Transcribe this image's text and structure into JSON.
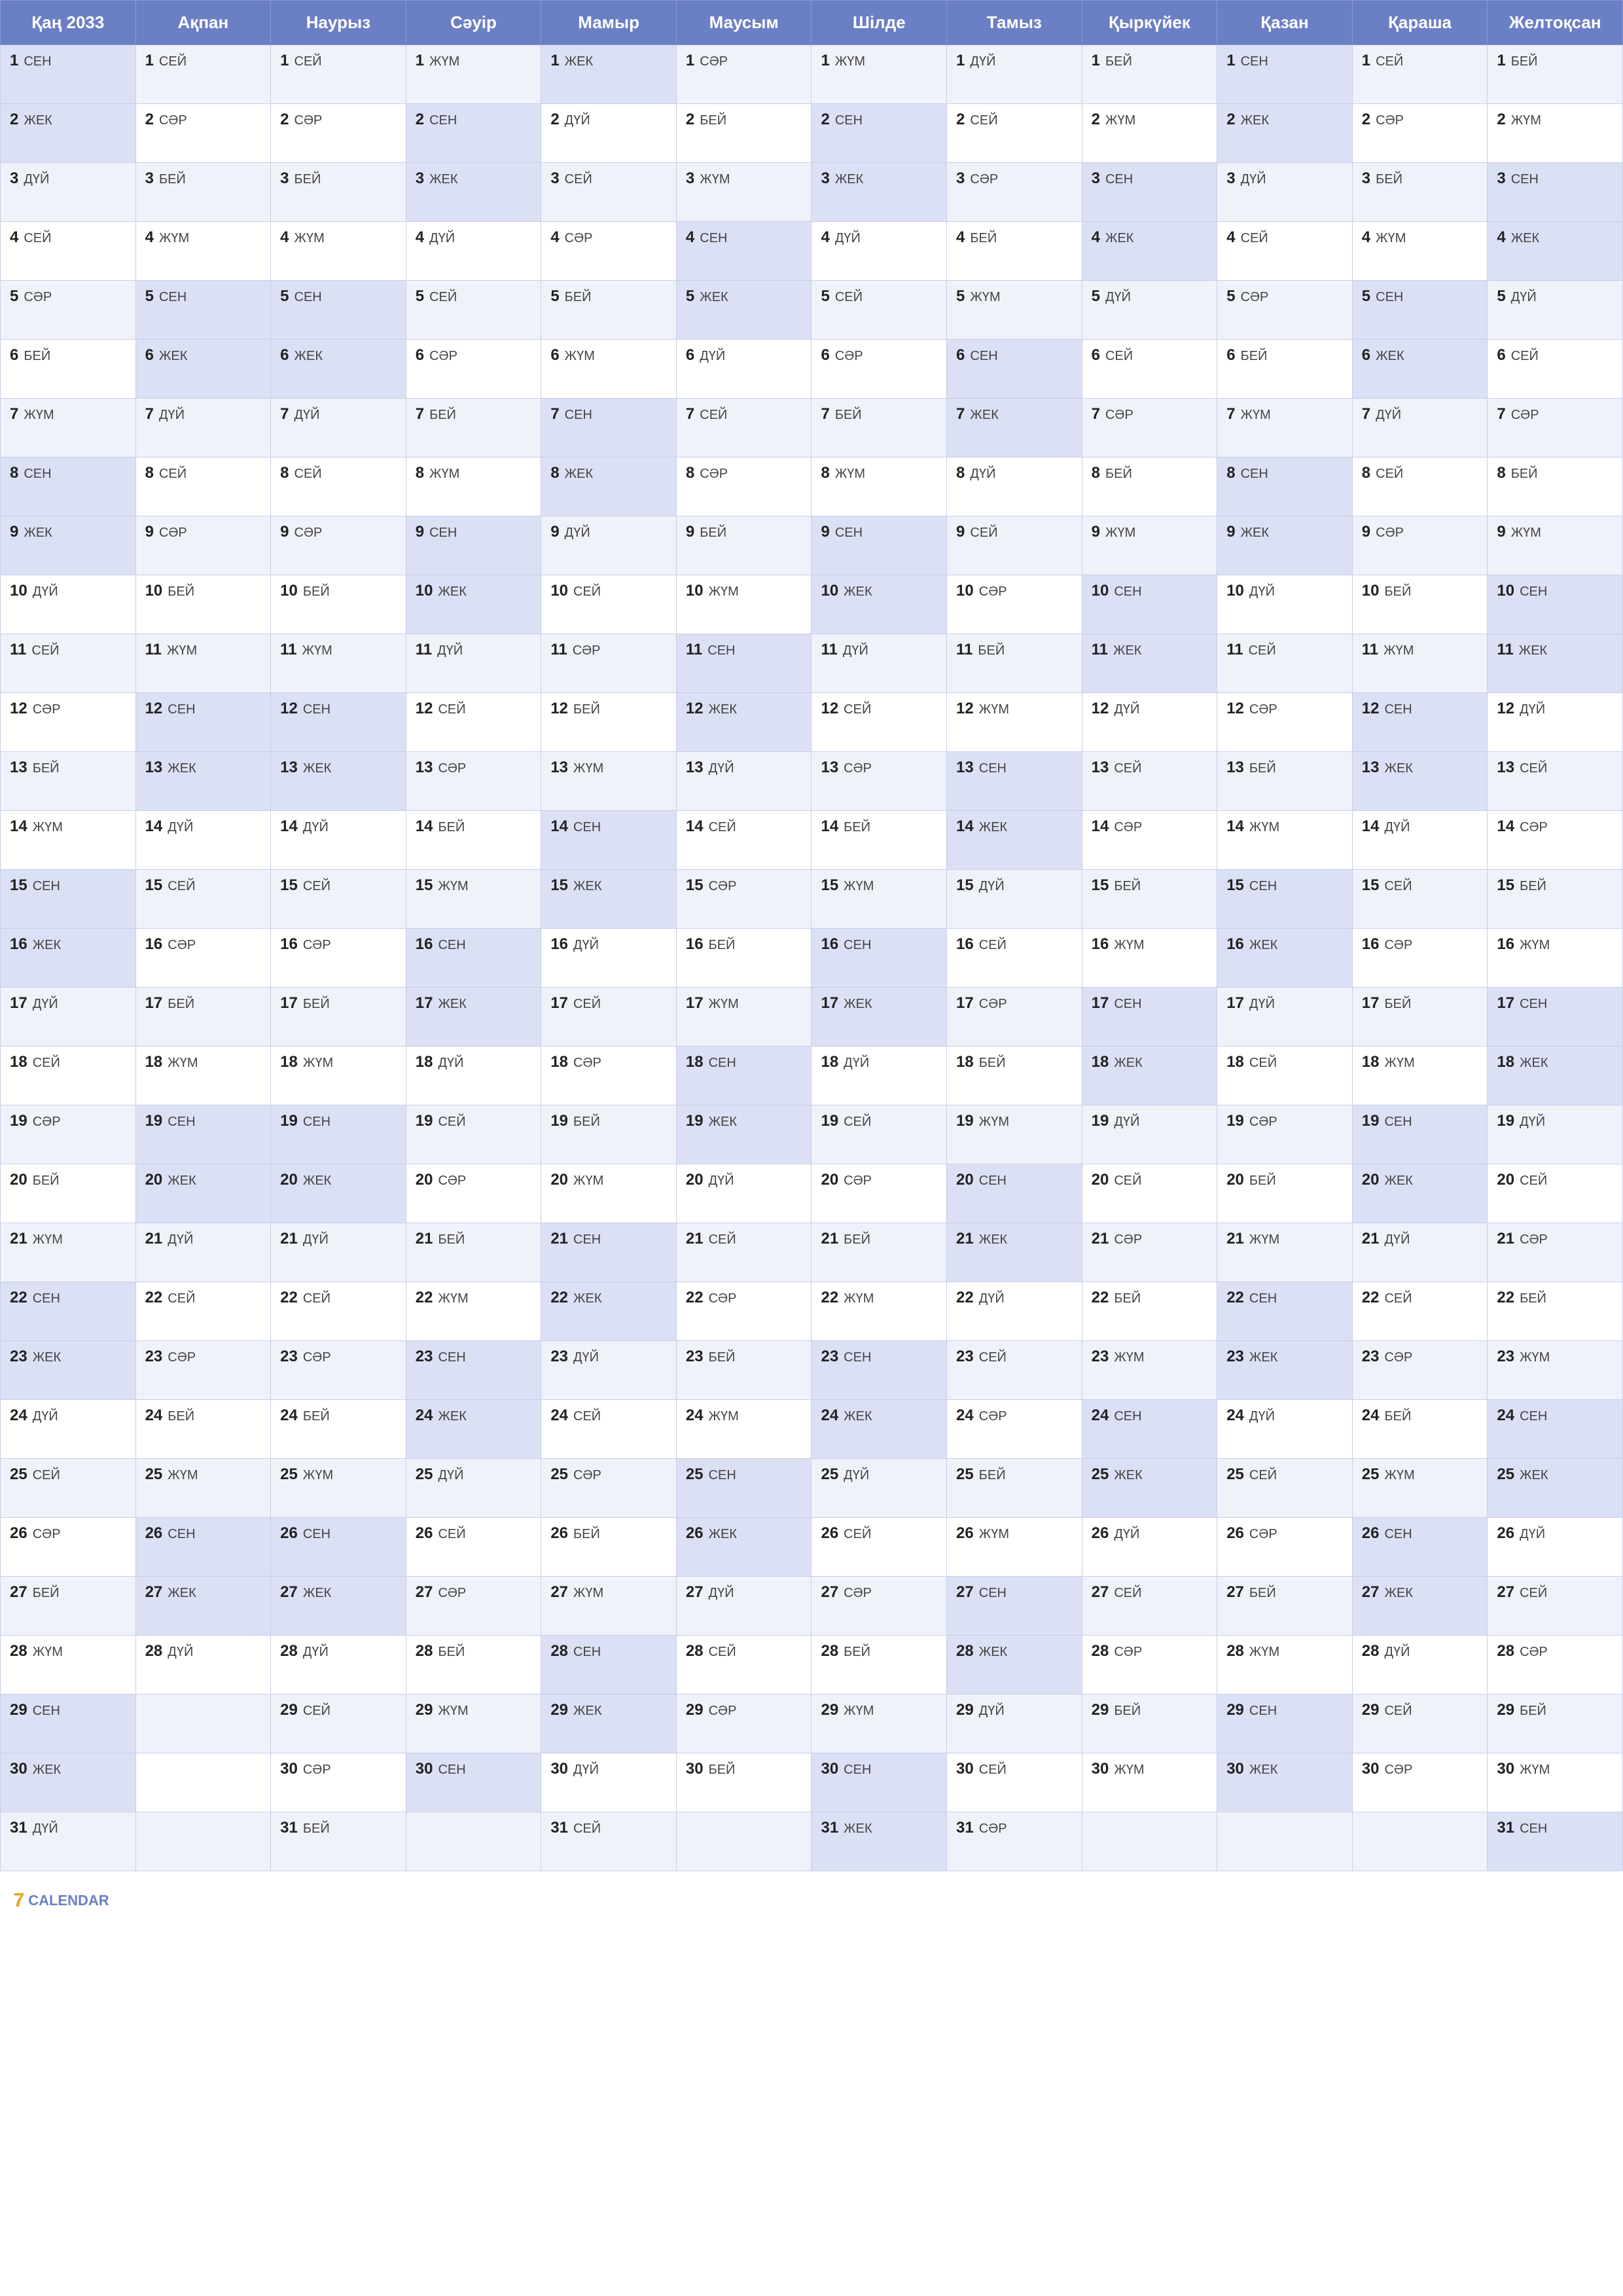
{
  "calendar": {
    "months": [
      "Қаң 2033",
      "Ақпан",
      "Наурыз",
      "Сәуір",
      "Мамыр",
      "Маусым",
      "Шілде",
      "Тамыз",
      "Қыркүйек",
      "Қазан",
      "Қараша",
      "Желтоқсан"
    ],
    "days": {
      "1": [
        "СЕН",
        "СЕЙ",
        "СЕЙ",
        "ЖҮМ",
        "ЖЕК",
        "СӘР",
        "ЖҮМ",
        "ДҮЙ",
        "БЕЙ",
        "СЕН",
        "СЕЙ",
        "БЕЙ"
      ],
      "2": [
        "ЖЕК",
        "СӘР",
        "СӘР",
        "СЕН",
        "ДҮЙ",
        "БЕЙ",
        "СЕН",
        "СЕЙ",
        "ЖҮМ",
        "ЖЕК",
        "СӘР",
        "ЖҮМ"
      ],
      "3": [
        "ДҮЙ",
        "БЕЙ",
        "БЕЙ",
        "ЖЕК",
        "СЕЙ",
        "ЖҮМ",
        "ЖЕК",
        "СӘР",
        "СЕН",
        "ДҮЙ",
        "БЕЙ",
        "СЕН"
      ],
      "4": [
        "СЕЙ",
        "ЖҮМ",
        "ЖҮМ",
        "ДҮЙ",
        "СӘР",
        "СЕН",
        "ДҮЙ",
        "БЕЙ",
        "ЖЕК",
        "СЕЙ",
        "ЖҮМ",
        "ЖЕК"
      ],
      "5": [
        "СӘР",
        "СЕН",
        "СЕН",
        "СЕЙ",
        "БЕЙ",
        "ЖЕК",
        "СЕЙ",
        "ЖҮМ",
        "ДҮЙ",
        "СӘР",
        "СЕН",
        "ДҮЙ"
      ],
      "6": [
        "БЕЙ",
        "ЖЕК",
        "ЖЕК",
        "СӘР",
        "ЖҮМ",
        "ДҮЙ",
        "СӘР",
        "СЕН",
        "СЕЙ",
        "БЕЙ",
        "ЖЕК",
        "СЕЙ"
      ],
      "7": [
        "ЖҮМ",
        "ДҮЙ",
        "ДҮЙ",
        "БЕЙ",
        "СЕН",
        "СЕЙ",
        "БЕЙ",
        "ЖЕК",
        "СӘР",
        "ЖҮМ",
        "ДҮЙ",
        "СӘР"
      ],
      "8": [
        "СЕН",
        "СЕЙ",
        "СЕЙ",
        "ЖҮМ",
        "ЖЕК",
        "СӘР",
        "ЖҮМ",
        "ДҮЙ",
        "БЕЙ",
        "СЕН",
        "СЕЙ",
        "БЕЙ"
      ],
      "9": [
        "ЖЕК",
        "СӘР",
        "СӘР",
        "СЕН",
        "ДҮЙ",
        "БЕЙ",
        "СЕН",
        "СЕЙ",
        "ЖҮМ",
        "ЖЕК",
        "СӘР",
        "ЖҮМ"
      ],
      "10": [
        "ДҮЙ",
        "БЕЙ",
        "БЕЙ",
        "ЖЕК",
        "СЕЙ",
        "ЖҮМ",
        "ЖЕК",
        "СӘР",
        "СЕН",
        "ДҮЙ",
        "БЕЙ",
        "СЕН"
      ],
      "11": [
        "СЕЙ",
        "ЖҮМ",
        "ЖҮМ",
        "ДҮЙ",
        "СӘР",
        "СЕН",
        "ДҮЙ",
        "БЕЙ",
        "ЖЕК",
        "СЕЙ",
        "ЖҮМ",
        "ЖЕК"
      ],
      "12": [
        "СӘР",
        "СЕН",
        "СЕН",
        "СЕЙ",
        "БЕЙ",
        "ЖЕК",
        "СЕЙ",
        "ЖҮМ",
        "ДҮЙ",
        "СӘР",
        "СЕН",
        "ДҮЙ"
      ],
      "13": [
        "БЕЙ",
        "ЖЕК",
        "ЖЕК",
        "СӘР",
        "ЖҮМ",
        "ДҮЙ",
        "СӘР",
        "СЕН",
        "СЕЙ",
        "БЕЙ",
        "ЖЕК",
        "СЕЙ"
      ],
      "14": [
        "ЖҮМ",
        "ДҮЙ",
        "ДҮЙ",
        "БЕЙ",
        "СЕН",
        "СЕЙ",
        "БЕЙ",
        "ЖЕК",
        "СӘР",
        "ЖҮМ",
        "ДҮЙ",
        "СӘР"
      ],
      "15": [
        "СЕН",
        "СЕЙ",
        "СЕЙ",
        "ЖҮМ",
        "ЖЕК",
        "СӘР",
        "ЖҮМ",
        "ДҮЙ",
        "БЕЙ",
        "СЕН",
        "СЕЙ",
        "БЕЙ"
      ],
      "16": [
        "ЖЕК",
        "СӘР",
        "СӘР",
        "СЕН",
        "ДҮЙ",
        "БЕЙ",
        "СЕН",
        "СЕЙ",
        "ЖҮМ",
        "ЖЕК",
        "СӘР",
        "ЖҮМ"
      ],
      "17": [
        "ДҮЙ",
        "БЕЙ",
        "БЕЙ",
        "ЖЕК",
        "СЕЙ",
        "ЖҮМ",
        "ЖЕК",
        "СӘР",
        "СЕН",
        "ДҮЙ",
        "БЕЙ",
        "СЕН"
      ],
      "18": [
        "СЕЙ",
        "ЖҮМ",
        "ЖҮМ",
        "ДҮЙ",
        "СӘР",
        "СЕН",
        "ДҮЙ",
        "БЕЙ",
        "ЖЕК",
        "СЕЙ",
        "ЖҮМ",
        "ЖЕК"
      ],
      "19": [
        "СӘР",
        "СЕН",
        "СЕН",
        "СЕЙ",
        "БЕЙ",
        "ЖЕК",
        "СЕЙ",
        "ЖҮМ",
        "ДҮЙ",
        "СӘР",
        "СЕН",
        "ДҮЙ"
      ],
      "20": [
        "БЕЙ",
        "ЖЕК",
        "ЖЕК",
        "СӘР",
        "ЖҮМ",
        "ДҮЙ",
        "СӘР",
        "СЕН",
        "СЕЙ",
        "БЕЙ",
        "ЖЕК",
        "СЕЙ"
      ],
      "21": [
        "ЖҮМ",
        "ДҮЙ",
        "ДҮЙ",
        "БЕЙ",
        "СЕН",
        "СЕЙ",
        "БЕЙ",
        "ЖЕК",
        "СӘР",
        "ЖҮМ",
        "ДҮЙ",
        "СӘР"
      ],
      "22": [
        "СЕН",
        "СЕЙ",
        "СЕЙ",
        "ЖҮМ",
        "ЖЕК",
        "СӘР",
        "ЖҮМ",
        "ДҮЙ",
        "БЕЙ",
        "СЕН",
        "СЕЙ",
        "БЕЙ"
      ],
      "23": [
        "ЖЕК",
        "СӘР",
        "СӘР",
        "СЕН",
        "ДҮЙ",
        "БЕЙ",
        "СЕН",
        "СЕЙ",
        "ЖҮМ",
        "ЖЕК",
        "СӘР",
        "ЖҮМ"
      ],
      "24": [
        "ДҮЙ",
        "БЕЙ",
        "БЕЙ",
        "ЖЕК",
        "СЕЙ",
        "ЖҮМ",
        "ЖЕК",
        "СӘР",
        "СЕН",
        "ДҮЙ",
        "БЕЙ",
        "СЕН"
      ],
      "25": [
        "СЕЙ",
        "ЖҮМ",
        "ЖҮМ",
        "ДҮЙ",
        "СӘР",
        "СЕН",
        "ДҮЙ",
        "БЕЙ",
        "ЖЕК",
        "СЕЙ",
        "ЖҮМ",
        "ЖЕК"
      ],
      "26": [
        "СӘР",
        "СЕН",
        "СЕН",
        "СЕЙ",
        "БЕЙ",
        "ЖЕК",
        "СЕЙ",
        "ЖҮМ",
        "ДҮЙ",
        "СӘР",
        "СЕН",
        "ДҮЙ"
      ],
      "27": [
        "БЕЙ",
        "ЖЕК",
        "ЖЕК",
        "СӘР",
        "ЖҮМ",
        "ДҮЙ",
        "СӘР",
        "СЕН",
        "СЕЙ",
        "БЕЙ",
        "ЖЕК",
        "СЕЙ"
      ],
      "28": [
        "ЖҮМ",
        "ДҮЙ",
        "ДҮЙ",
        "БЕЙ",
        "СЕН",
        "СЕЙ",
        "БЕЙ",
        "ЖЕК",
        "СӘР",
        "ЖҮМ",
        "ДҮЙ",
        "СӘР"
      ],
      "29": [
        "СЕН",
        "",
        "СЕЙ",
        "ЖҮМ",
        "ЖЕК",
        "СӘР",
        "ЖҮМ",
        "ДҮЙ",
        "БЕЙ",
        "СЕН",
        "СЕЙ",
        "БЕЙ"
      ],
      "30": [
        "ЖЕК",
        "",
        "СӘР",
        "СЕН",
        "ДҮЙ",
        "БЕЙ",
        "СЕН",
        "СЕЙ",
        "ЖҮМ",
        "ЖЕК",
        "СӘР",
        "ЖҮМ"
      ],
      "31": [
        "ДҮЙ",
        "",
        "БЕЙ",
        "",
        "СЕЙ",
        "",
        "ЖЕК",
        "СӘР",
        "",
        "",
        "",
        "СЕН"
      ]
    },
    "footer": {
      "brand_number": "7",
      "brand_text": "CALENDAR"
    }
  }
}
